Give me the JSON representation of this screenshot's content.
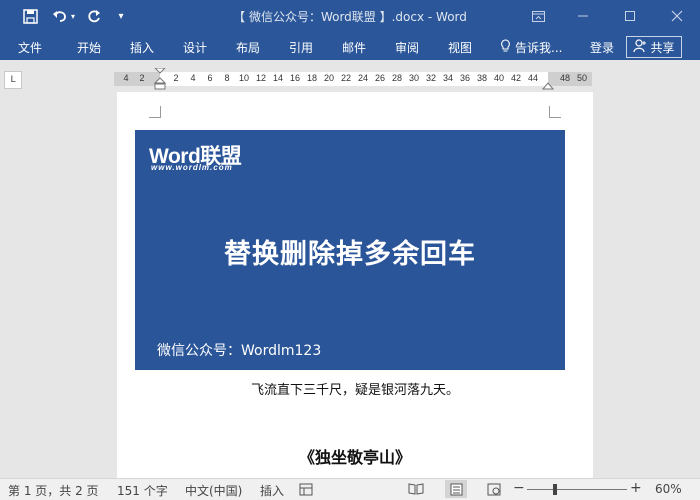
{
  "app": {
    "title": "【 微信公众号：Word联盟 】.docx - Word",
    "qat": [
      "save-icon",
      "undo-icon",
      "redo-icon",
      "customize-qat-icon"
    ]
  },
  "window_controls": [
    "ribbon-display-options-icon",
    "minimize-icon",
    "maximize-icon",
    "close-icon"
  ],
  "ribbon": {
    "tabs": [
      "文件",
      "开始",
      "插入",
      "设计",
      "布局",
      "引用",
      "邮件",
      "审阅",
      "视图"
    ],
    "tell_me": "告诉我...",
    "login": "登录",
    "share": "共享"
  },
  "ruler": {
    "corner": "L",
    "numbers": [
      "4",
      "2",
      "2",
      "4",
      "6",
      "8",
      "10",
      "12",
      "14",
      "16",
      "18",
      "20",
      "22",
      "24",
      "26",
      "28",
      "30",
      "32",
      "34",
      "36",
      "38",
      "40",
      "42",
      "44",
      "48",
      "50"
    ]
  },
  "document": {
    "banner": {
      "logo": "Word联盟",
      "logo_url": "www.wordlm.com",
      "title": "替换删除掉多余回车",
      "footer": "微信公众号：Wordlm123"
    },
    "poem_line": "飞流直下三千尺，疑是银河落九天。",
    "poem_title": "《独坐敬亭山》"
  },
  "statusbar": {
    "page": "第 1 页，共 2 页",
    "words": "151 个字",
    "language": "中文(中国)",
    "mode": "插入",
    "zoom_level": "60%",
    "zoom_fraction": 0.6
  },
  "colors": {
    "brand": "#2b579a",
    "banner": "#2a5599"
  }
}
